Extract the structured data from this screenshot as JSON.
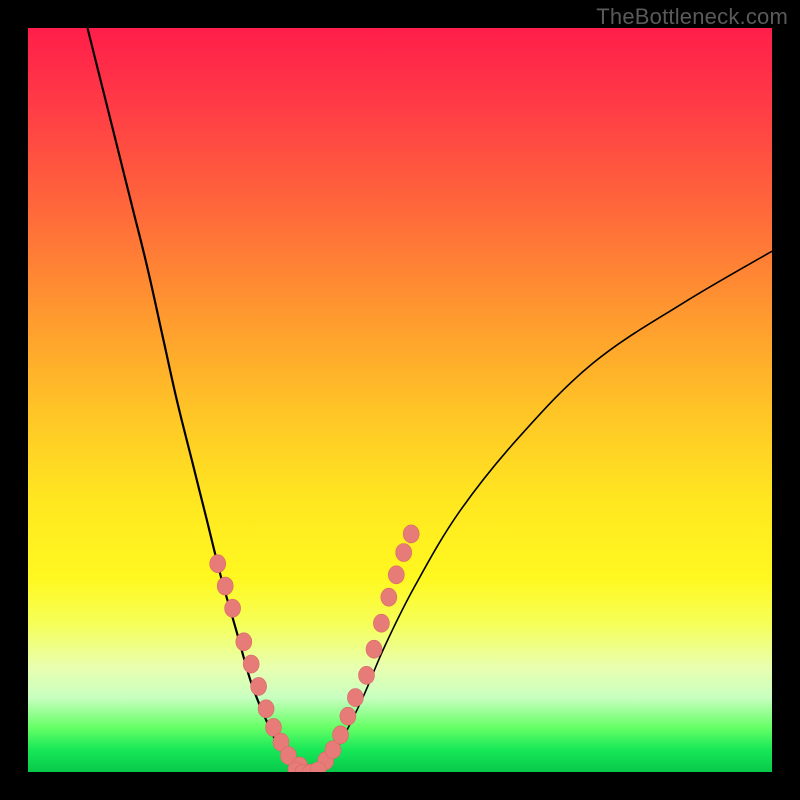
{
  "watermark": {
    "text": "TheBottleneck.com"
  },
  "chart_data": {
    "type": "line",
    "title": "",
    "xlabel": "",
    "ylabel": "",
    "xlim": [
      0,
      100
    ],
    "ylim": [
      0,
      100
    ],
    "grid": false,
    "legend": false,
    "series": [
      {
        "name": "left-curve",
        "x": [
          8,
          10,
          12,
          14,
          16,
          18,
          20,
          22,
          24,
          26,
          28,
          30,
          32,
          34,
          36,
          38
        ],
        "y": [
          100,
          92,
          84,
          76,
          68,
          59,
          50,
          42,
          34,
          26,
          19,
          12,
          7,
          3,
          1,
          0
        ]
      },
      {
        "name": "right-curve",
        "x": [
          38,
          40,
          42,
          45,
          48,
          52,
          58,
          66,
          76,
          88,
          100
        ],
        "y": [
          0,
          1,
          4,
          10,
          17,
          25,
          35,
          45,
          55,
          63,
          70
        ]
      },
      {
        "name": "left-beads",
        "x": [
          25.5,
          26.5,
          27.5,
          29.0,
          30.0,
          31.0,
          32.0,
          33.0,
          34.0,
          35.0,
          36.5
        ],
        "y": [
          28.0,
          25.0,
          22.0,
          17.5,
          14.5,
          11.5,
          8.5,
          6.0,
          4.0,
          2.2,
          0.8
        ]
      },
      {
        "name": "right-beads",
        "x": [
          40.0,
          41.0,
          42.0,
          43.0,
          44.0,
          45.5,
          46.5,
          47.5,
          48.5,
          49.5,
          50.5,
          51.5
        ],
        "y": [
          1.5,
          3.0,
          5.0,
          7.5,
          10.0,
          13.0,
          16.5,
          20.0,
          23.5,
          26.5,
          29.5,
          32.0
        ]
      },
      {
        "name": "bottom-beads",
        "x": [
          36.0,
          37.0,
          38.0,
          39.0
        ],
        "y": [
          0.4,
          0.1,
          0.1,
          0.4
        ]
      }
    ],
    "gradient_stops": [
      {
        "pos": 0,
        "color": "#ff1e4a"
      },
      {
        "pos": 10,
        "color": "#ff3a46"
      },
      {
        "pos": 25,
        "color": "#ff6a3a"
      },
      {
        "pos": 40,
        "color": "#ff9e2e"
      },
      {
        "pos": 52,
        "color": "#ffc626"
      },
      {
        "pos": 64,
        "color": "#ffe820"
      },
      {
        "pos": 74,
        "color": "#fff820"
      },
      {
        "pos": 80,
        "color": "#f6ff58"
      },
      {
        "pos": 86,
        "color": "#e8ffb0"
      },
      {
        "pos": 90,
        "color": "#c8ffc0"
      },
      {
        "pos": 94,
        "color": "#66ff66"
      },
      {
        "pos": 97,
        "color": "#18e858"
      },
      {
        "pos": 100,
        "color": "#07c84a"
      }
    ],
    "bead_color": "#e77b78"
  }
}
